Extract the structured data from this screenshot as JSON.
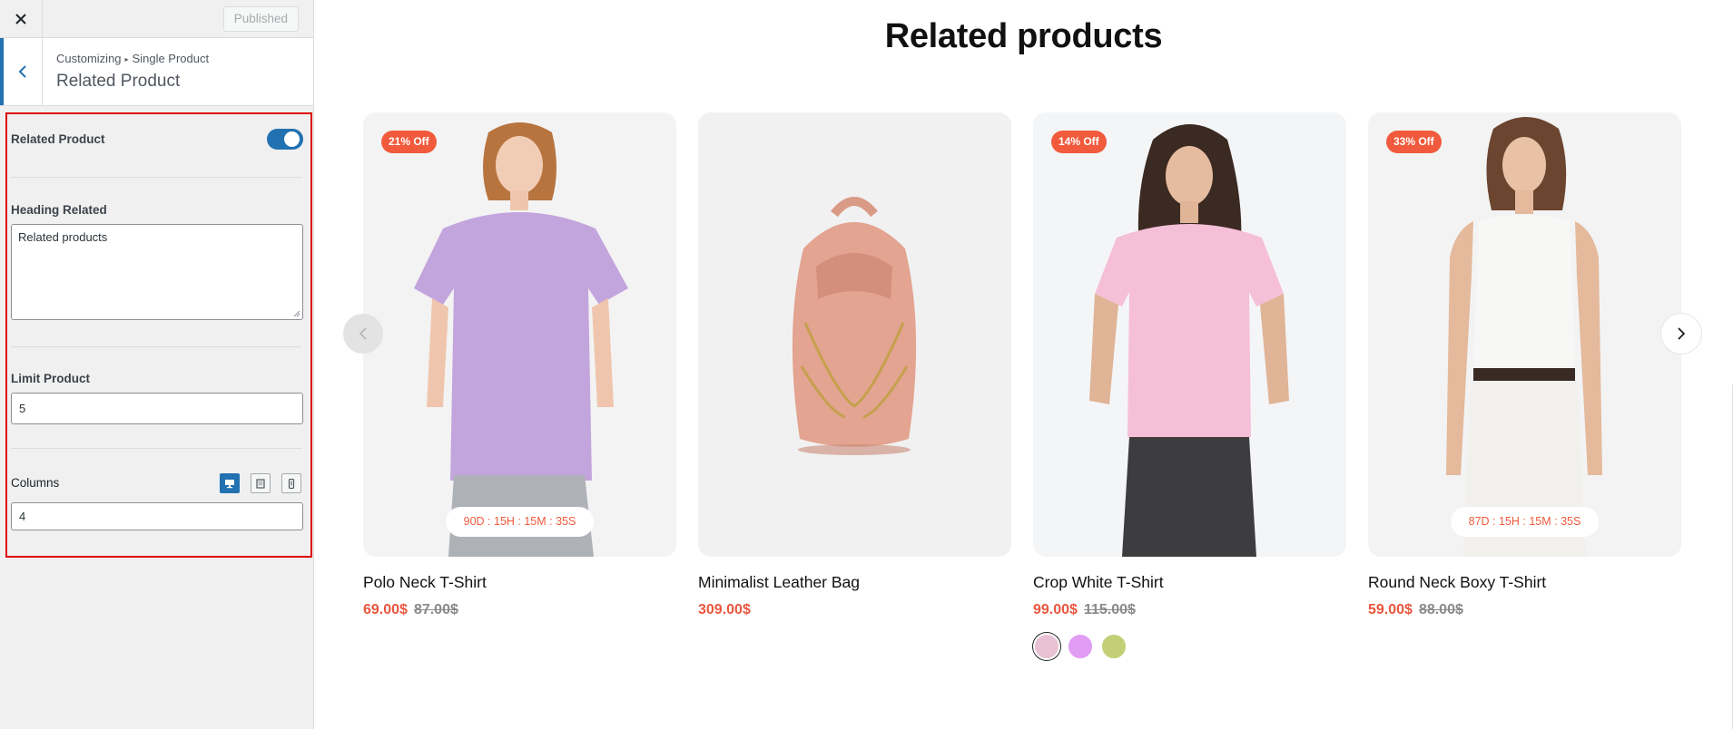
{
  "customizer": {
    "published_label": "Published",
    "breadcrumb": {
      "root": "Customizing",
      "separator": "▸",
      "parent": "Single Product"
    },
    "section_title": "Related Product",
    "controls": {
      "related_toggle_label": "Related Product",
      "related_toggle_on": true,
      "heading_label": "Heading Related",
      "heading_value": "Related products",
      "limit_label": "Limit Product",
      "limit_value": "5",
      "columns_label": "Columns",
      "columns_value": "4",
      "devices": [
        "desktop-icon",
        "tablet-icon",
        "mobile-icon"
      ],
      "active_device": "desktop"
    },
    "accent_color": "#2271b1",
    "highlight_color": "#e00000"
  },
  "preview": {
    "heading": "Related products",
    "products": [
      {
        "name": "Polo Neck T-Shirt",
        "price": "69.00$",
        "old_price": "87.00$",
        "badge": "21% Off",
        "timer": "90D : 15H : 15M : 35S",
        "image": "lavender-tshirt-model",
        "bg": "#f3f3f3"
      },
      {
        "name": "Minimalist Leather Bag",
        "price": "309.00$",
        "old_price": "",
        "badge": "",
        "timer": "",
        "image": "pink-leather-backpack",
        "bg": "#f1f1f1"
      },
      {
        "name": "Crop White T-Shirt",
        "price": "99.00$",
        "old_price": "115.00$",
        "badge": "14% Off",
        "timer": "",
        "image": "pink-tshirt-model",
        "bg": "#f4f5f7",
        "swatches": [
          "#e8c1d3",
          "#e19cf3",
          "#c3cf77"
        ]
      },
      {
        "name": "Round Neck Boxy T-Shirt",
        "price": "59.00$",
        "old_price": "88.00$",
        "badge": "33% Off",
        "timer": "87D : 15H : 15M : 35S",
        "image": "white-tank-model",
        "bg": "#f3f3f3"
      }
    ],
    "price_color": "#e9573f",
    "badge_color": "#f15a3c"
  }
}
